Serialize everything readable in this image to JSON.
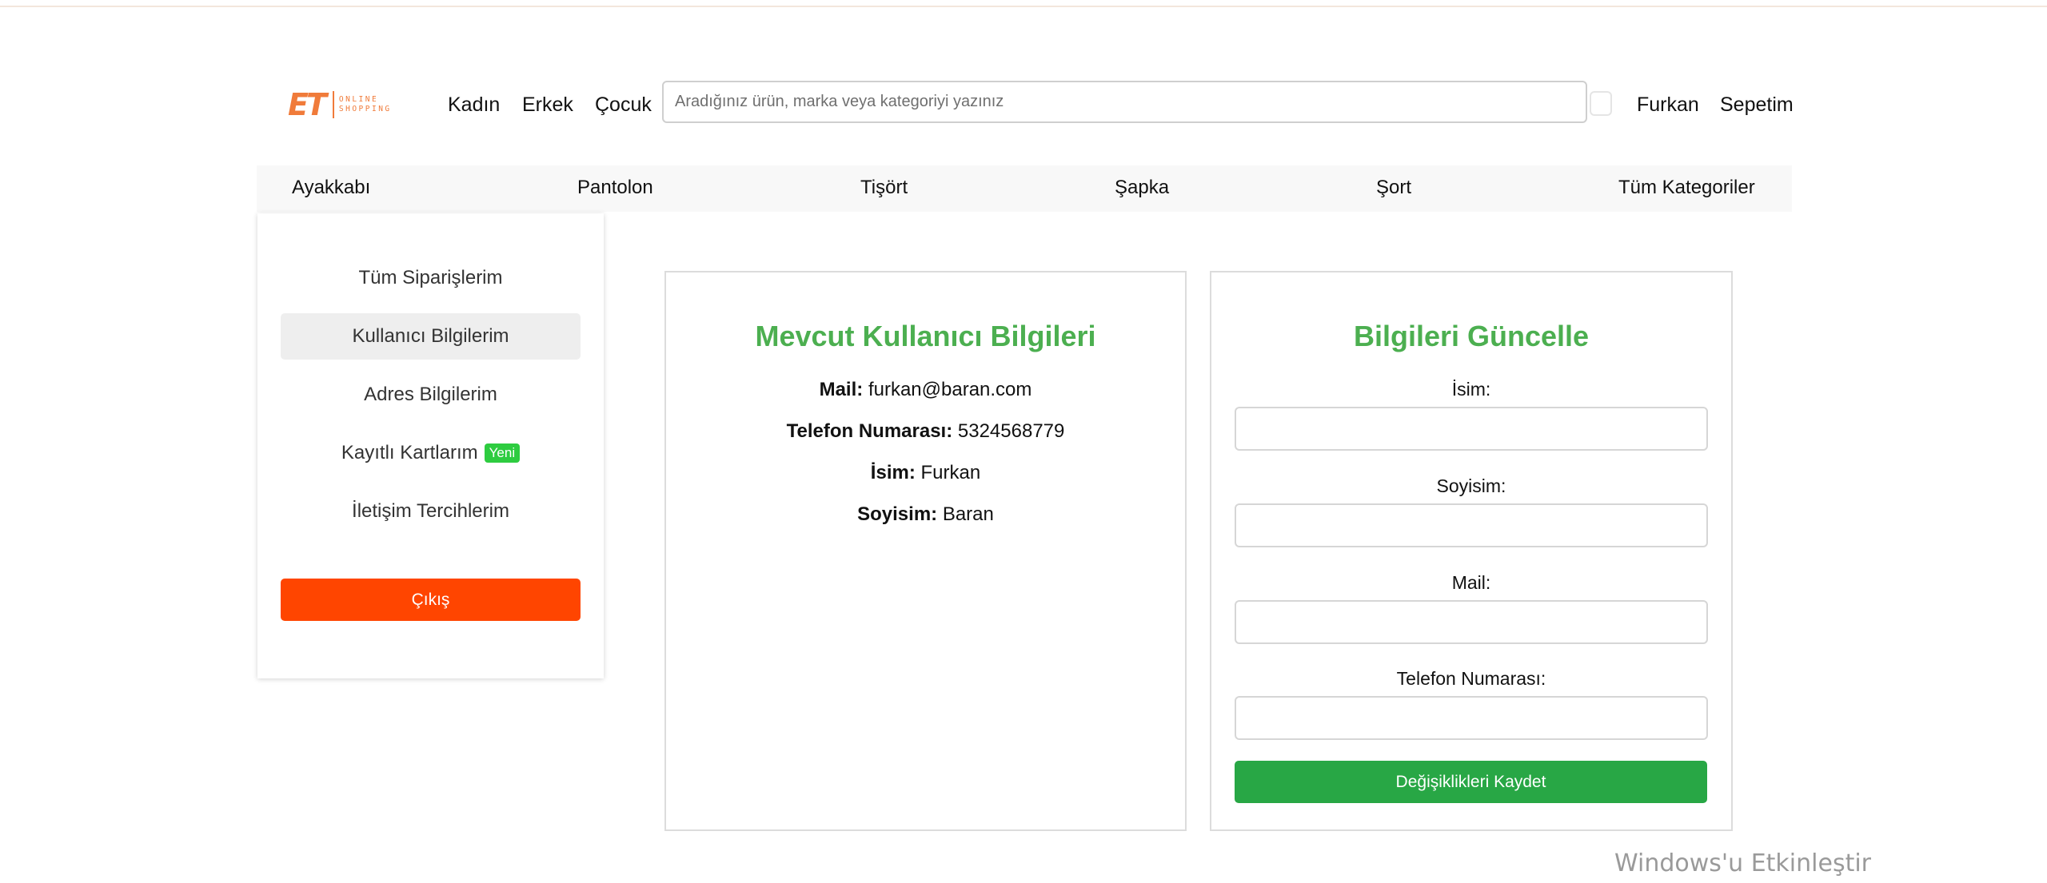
{
  "header": {
    "logo": {
      "mark": "ET",
      "line1": "ONLINE",
      "line2": "SHOPPING",
      "color": "#f07b3a"
    },
    "nav": [
      "Kadın",
      "Erkek",
      "Çocuk"
    ],
    "search_placeholder": "Aradığınız ürün, marka veya kategoriyi yazınız",
    "user": "Furkan",
    "cart": "Sepetim"
  },
  "categories": [
    "Ayakkabı",
    "Pantolon",
    "Tişört",
    "Şapka",
    "Şort",
    "Tüm Kategoriler"
  ],
  "sidebar": {
    "items": [
      {
        "label": "Tüm Siparişlerim"
      },
      {
        "label": "Kullanıcı Bilgilerim",
        "active": true
      },
      {
        "label": "Adres Bilgilerim"
      },
      {
        "label": "Kayıtlı Kartlarım",
        "badge": "Yeni"
      },
      {
        "label": "İletişim Tercihlerim"
      }
    ],
    "logout": "Çıkış"
  },
  "current_info": {
    "title": "Mevcut Kullanıcı Bilgileri",
    "fields": [
      {
        "label": "Mail:",
        "value": "furkan@baran.com"
      },
      {
        "label": "Telefon Numarası:",
        "value": "5324568779"
      },
      {
        "label": "İsim:",
        "value": "Furkan"
      },
      {
        "label": "Soyisim:",
        "value": "Baran"
      }
    ]
  },
  "update_form": {
    "title": "Bilgileri Güncelle",
    "fields": [
      {
        "label": "İsim:",
        "value": ""
      },
      {
        "label": "Soyisim:",
        "value": ""
      },
      {
        "label": "Mail:",
        "value": ""
      },
      {
        "label": "Telefon Numarası:",
        "value": ""
      }
    ],
    "save": "Değişiklikleri Kaydet"
  },
  "colors": {
    "accent_green": "#4caf50",
    "save_green": "#28a745",
    "logout_orange": "#ff4500",
    "badge_green": "#2ecc40"
  },
  "watermark": "Windows'u Etkinleştir"
}
